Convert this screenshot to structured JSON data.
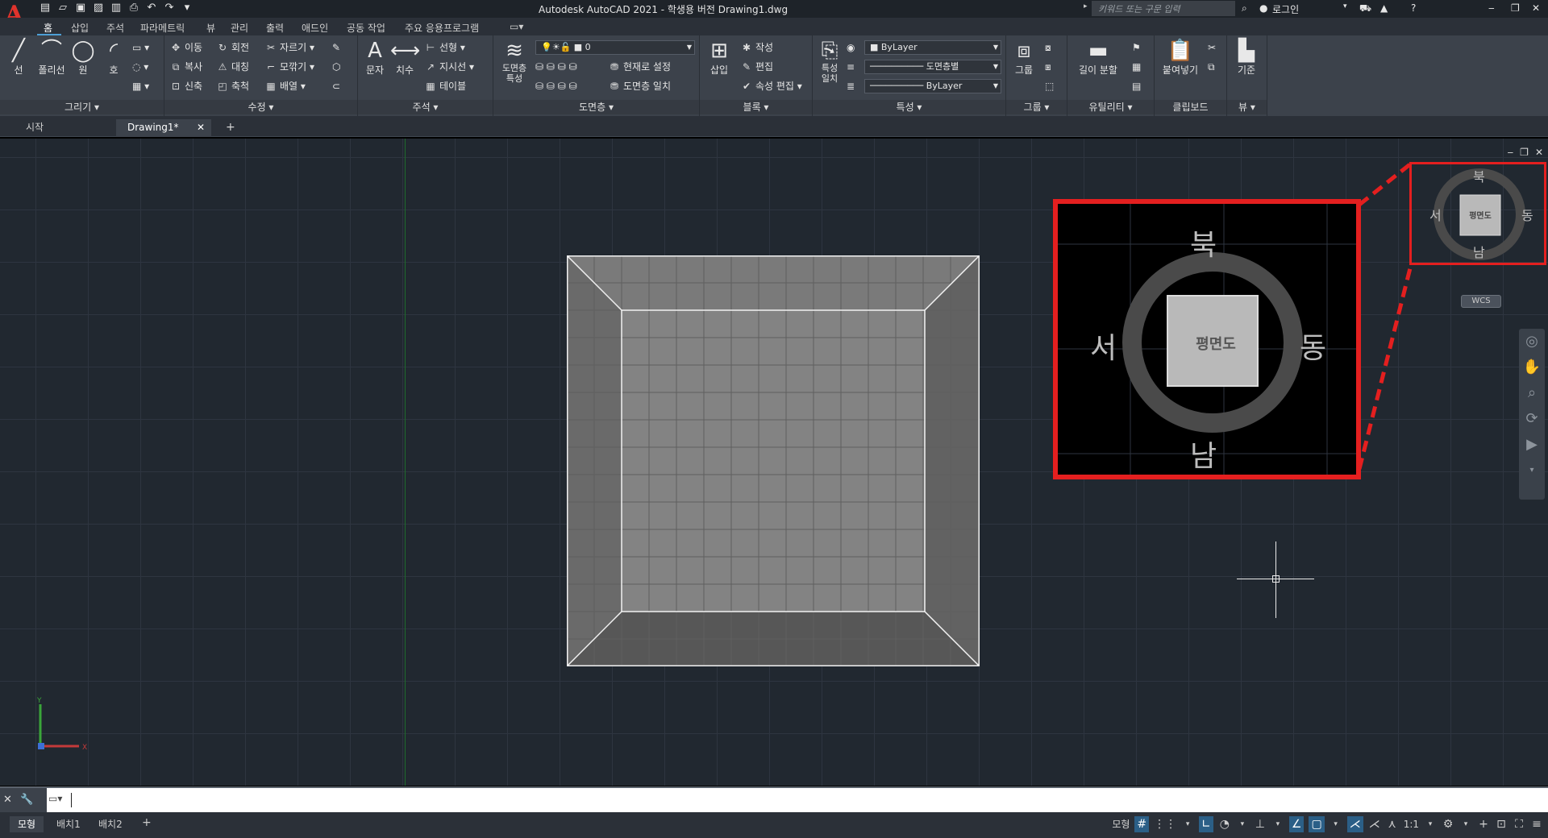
{
  "app": {
    "title": "Autodesk AutoCAD 2021 - 학생용 버전    Drawing1.dwg",
    "logo": "A",
    "search_placeholder": "키워드 또는 구문 입력",
    "login": "로그인"
  },
  "qat_icons": [
    "new-icon",
    "open-icon",
    "save-icon",
    "saveas-icon",
    "publish-icon",
    "print-icon",
    "undo-icon",
    "redo-icon",
    "customize-icon"
  ],
  "ribbon_tabs": [
    "홈",
    "삽입",
    "주석",
    "파라메트릭",
    "뷰",
    "관리",
    "출력",
    "애드인",
    "공동 작업",
    "주요 응용프로그램"
  ],
  "panels": {
    "draw": {
      "title": "그리기 ▾",
      "line": "선",
      "polyline": "폴리선",
      "circle": "원",
      "arc": "호"
    },
    "modify": {
      "title": "수정 ▾",
      "move": "이동",
      "rotate": "회전",
      "trim": "자르기",
      "copy": "복사",
      "mirror": "대칭",
      "fillet": "모깎기",
      "stretch": "신축",
      "scale": "축척",
      "array": "배열"
    },
    "annotation": {
      "title": "주석 ▾",
      "text": "문자",
      "dimension": "치수",
      "linear": "선형",
      "leader": "지시선",
      "table": "테이블"
    },
    "layers": {
      "title": "도면층 ▾",
      "properties": "도면층\n특성",
      "layer_value": "0",
      "set_current": "현재로 설정",
      "match": "도면층 일치"
    },
    "block": {
      "title": "블록 ▾",
      "insert": "삽입",
      "create": "작성",
      "edit": "편집",
      "attr_edit": "속성 편집"
    },
    "properties": {
      "title": "특성 ▾",
      "match": "특성\n일치",
      "color": "ByLayer",
      "linetype": "도면층별",
      "lineweight": "ByLayer"
    },
    "groups": {
      "title": "그룹 ▾",
      "group": "그룹"
    },
    "utilities": {
      "title": "유틸리티 ▾",
      "measure": "길이 분할"
    },
    "clipboard": {
      "title": "클립보드",
      "paste": "붙여넣기"
    },
    "view": {
      "title": "뷰 ▾",
      "base": "기준"
    }
  },
  "file_tabs": [
    "시작",
    "Drawing1*"
  ],
  "viewcube": {
    "north": "북",
    "south": "남",
    "east": "동",
    "west": "서",
    "face": "평면도",
    "wcs": "WCS"
  },
  "command_line": {
    "value": ""
  },
  "layout_tabs": [
    "모형",
    "배치1",
    "배치2"
  ],
  "status": {
    "model": "모형",
    "scale": "1:1"
  },
  "colors": {
    "highlight": "#e41f1f",
    "ribbon_bg": "#3c424b",
    "viewport_bg": "#212830",
    "accent": "#4d9fd6"
  }
}
